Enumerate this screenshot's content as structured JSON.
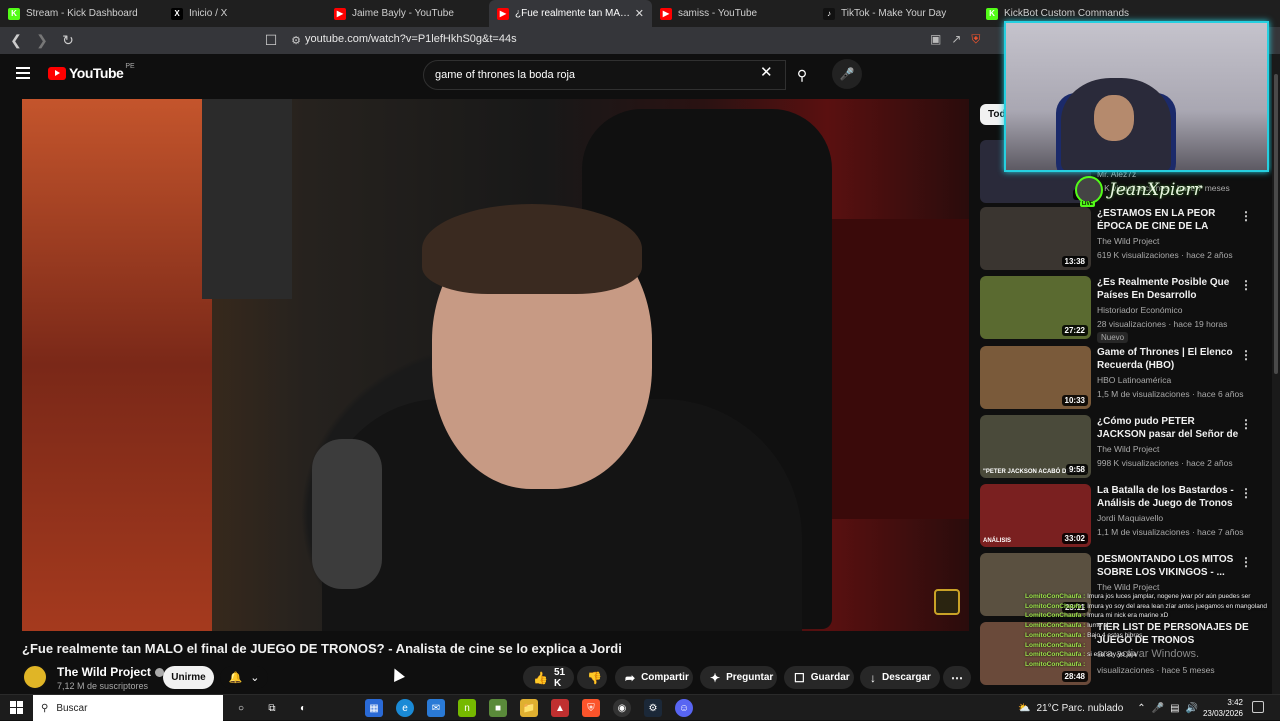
{
  "browser": {
    "tabs": [
      {
        "title": "Stream - Kick Dashboard",
        "fav_color": "#53fc18",
        "fav_glyph": "K",
        "active": false
      },
      {
        "title": "Inicio / X",
        "fav_color": "#000000",
        "fav_glyph": "X",
        "active": false
      },
      {
        "title": "Jaime Bayly - YouTube",
        "fav_color": "#ff0000",
        "fav_glyph": "▶",
        "active": false
      },
      {
        "title": "¿Fue realmente tan MALO el",
        "fav_color": "#ff0000",
        "fav_glyph": "▶",
        "active": true
      },
      {
        "title": "samiss - YouTube",
        "fav_color": "#ff0000",
        "fav_glyph": "▶",
        "active": false
      },
      {
        "title": "TikTok - Make Your Day",
        "fav_color": "#111111",
        "fav_glyph": "♪",
        "active": false
      },
      {
        "title": "KickBot Custom Commands",
        "fav_color": "#53fc18",
        "fav_glyph": "K",
        "active": false
      }
    ],
    "url": "youtube.com/watch?v=P1lefHkhS0g&t=44s"
  },
  "yt": {
    "logo_text": "YouTube",
    "country": "PE",
    "search_value": "game of thrones la boda roja"
  },
  "video": {
    "title": "¿Fue realmente tan MALO el final de JUEGO DE TRONOS? - Analista de cine se lo explica a Jordi",
    "channel": "The Wild Project",
    "subscribers": "7,12 M de suscriptores",
    "join_label": "Unirme",
    "likes": "51 K",
    "share_label": "Compartir",
    "ask_label": "Preguntar",
    "save_label": "Guardar",
    "download_label": "Descargar"
  },
  "sidebar": {
    "chip": "Tod",
    "top_partial": {
      "meta": "9 K visualizaciones · hace 7 meses",
      "dur": "33",
      "chan": "Mr. Alez7z"
    },
    "items": [
      {
        "title": "¿ESTAMOS EN LA PEOR ÉPOCA DE CINE DE LA HISTORIA? - ...",
        "channel": "The Wild Project",
        "meta": "619 K visualizaciones · hace 2 años",
        "dur": "13:38",
        "thumb": "#3a3530",
        "label": ""
      },
      {
        "title": "¿Es Realmente Posible Que Países En Desarrollo Alcancen...",
        "channel": "Historiador Económico",
        "meta": "28 visualizaciones · hace 19 horas",
        "dur": "27:22",
        "thumb": "#5a6a30",
        "label": "",
        "badge": "Nuevo"
      },
      {
        "title": "Game of Thrones | El Elenco Recuerda (HBO)",
        "channel": "HBO Latinoamérica",
        "meta": "1,5 M de visualizaciones · hace 6 años",
        "dur": "10:33",
        "thumb": "#7a5a3a",
        "label": ""
      },
      {
        "title": "¿Cómo pudo PETER JACKSON pasar del Señor de los Anillos ...",
        "channel": "The Wild Project",
        "meta": "998 K visualizaciones · hace 2 años",
        "dur": "9:58",
        "thumb": "#4a4a3a",
        "label": "\"PETER JACKSON ACABÓ DESTR..."
      },
      {
        "title": "La Batalla de los Bastardos - Análisis de Juego de Tronos",
        "channel": "Jordi Maquiavello",
        "meta": "1,1 M de visualizaciones · hace 7 años",
        "dur": "33:02",
        "thumb": "#7a2020",
        "label": "ANÁLISIS"
      },
      {
        "title": "DESMONTANDO LOS MITOS SOBRE LOS VIKINGOS - ...",
        "channel": "The Wild Project",
        "meta": "",
        "dur": "23:11",
        "thumb": "#5a5040",
        "label": ""
      }
    ],
    "last_title": "TIER LIST DE PERSONAJES DE JUEGO DE TRONOS",
    "last_meta": "visualizaciones · hace 5 meses",
    "last_dur": "28:48"
  },
  "overlay": {
    "streamer": "JeanXpierr",
    "live": "LIVE",
    "chat": [
      {
        "u": "LomitoConChaufa :",
        "m": "Imura jos luces jamplar, nogene jwar pór aún puedes ser"
      },
      {
        "u": "LomitoConChaufa :",
        "m": "Imura yo soy del area lean zíar antes juegamos en mangoland"
      },
      {
        "u": "LomitoConChaufa :",
        "m": "Imura mi nick era marine xD"
      },
      {
        "u": "LomitoConChaufa :",
        "m": "Iumo al..."
      },
      {
        "u": "LomitoConChaufa :",
        "m": "Bajo 4 estas hibras"
      },
      {
        "u": "LomitoConChaufa :",
        "m": ""
      },
      {
        "u": "LomitoConChaufa :",
        "m": "si esa soy yo jaja"
      },
      {
        "u": "LomitoConChaufa :",
        "m": ""
      }
    ],
    "windows_watermark": "ara activar Windows."
  },
  "taskbar": {
    "search_placeholder": "Buscar",
    "weather": "21°C  Parc. nublado",
    "time": "3:42",
    "date": "23/03/2026"
  }
}
